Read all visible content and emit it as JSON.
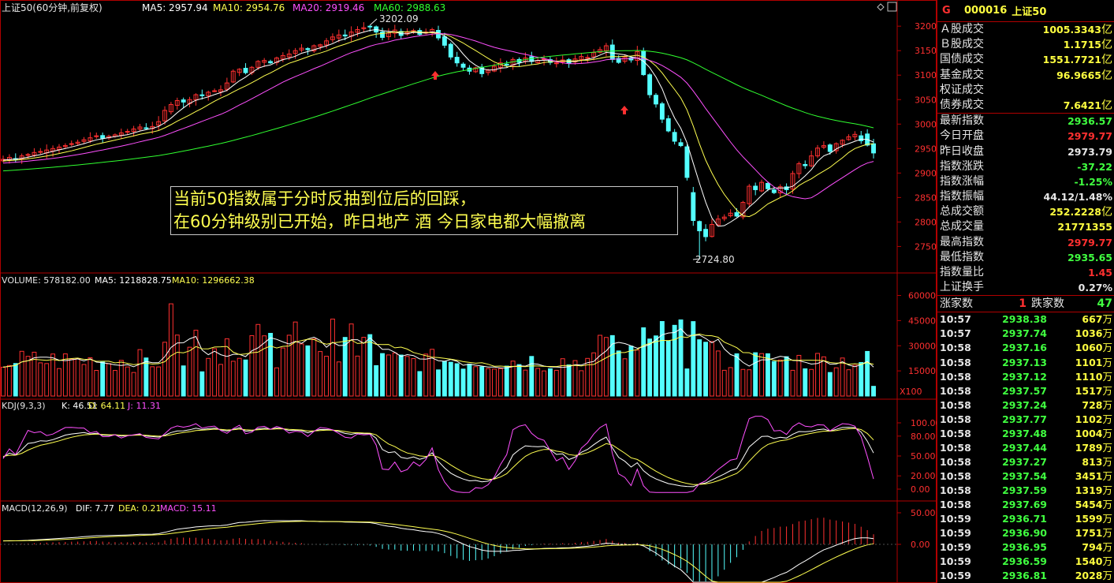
{
  "colors": {
    "up": "#ff3030",
    "down": "#54ffff",
    "ma5": "#ffffff",
    "ma10": "#ffff50",
    "ma20": "#ff50ff",
    "ma60": "#30ff30",
    "frame": "#b00000"
  },
  "kline": {
    "title": "上证50(60分钟,前复权)",
    "ma5": "MA5: 2957.94",
    "ma10": "MA10: 2954.76",
    "ma20": "MA20: 2919.46",
    "ma60": "MA60: 2988.63",
    "high_mark": "3202.09",
    "low_mark": "2724.80",
    "axis_ticks": [
      "3200",
      "3150",
      "3100",
      "3050",
      "3000",
      "2950",
      "2900",
      "2850",
      "2800",
      "2750"
    ]
  },
  "annotation": {
    "line1": "当前50指数属于分时反抽到位后的回踩，",
    "line2": "在60分钟级别已开始，昨日地产 酒  今日家电都大幅撤离"
  },
  "volume": {
    "label": "VOLUME: 578182.00",
    "ma5": "MA5: 1218828.75",
    "ma10": "MA10: 1296662.38",
    "axis_ticks": [
      "60000",
      "45000",
      "30000",
      "15000"
    ],
    "unit": "X100"
  },
  "kdj": {
    "label": "KDJ(9,3,3)",
    "k": "K: 46.51",
    "d": "D: 64.11",
    "j": "J: 11.31",
    "axis_ticks": [
      "100.00",
      "80.00",
      "50.00",
      "20.00",
      "0.00"
    ]
  },
  "macd": {
    "label": "MACD(12,26,9)",
    "dif": "DIF: 7.77",
    "dea": "DEA: 0.21",
    "macd": "MACD: 15.11",
    "axis_ticks": [
      "50.00",
      "0.00"
    ]
  },
  "side": {
    "g": "G",
    "code": "000016",
    "name": "上证50",
    "stats": [
      {
        "label": "Ａ股成交",
        "value": "1005.3343亿",
        "color": "#ffff40"
      },
      {
        "label": "Ｂ股成交",
        "value": "1.1715亿",
        "color": "#ffff40"
      },
      {
        "label": "国债成交",
        "value": "1551.7721亿",
        "color": "#ffff40"
      },
      {
        "label": "基金成交",
        "value": "96.9665亿",
        "color": "#ffff40"
      },
      {
        "label": "权证成交",
        "value": "",
        "color": "#ffff40"
      },
      {
        "label": "债券成交",
        "value": "7.6421亿",
        "color": "#ffff40"
      }
    ],
    "quotes": [
      {
        "label": "最新指数",
        "value": "2936.57",
        "color": "#40ff40"
      },
      {
        "label": "今日开盘",
        "value": "2979.77",
        "color": "#ff3030"
      },
      {
        "label": "昨日收盘",
        "value": "2973.79",
        "color": "#e6e6e6"
      },
      {
        "label": "指数涨跌",
        "value": "-37.22",
        "color": "#40ff40"
      },
      {
        "label": "指数涨幅",
        "value": "-1.25%",
        "color": "#40ff40"
      },
      {
        "label": "指数振幅",
        "value": "44.12/1.48%",
        "color": "#e6e6e6"
      },
      {
        "label": "总成交额",
        "value": "252.2228亿",
        "color": "#ffff40"
      },
      {
        "label": "总成交量",
        "value": "21771355",
        "color": "#ffff40"
      },
      {
        "label": "最高指数",
        "value": "2979.77",
        "color": "#ff3030"
      },
      {
        "label": "最低指数",
        "value": "2935.65",
        "color": "#40ff40"
      },
      {
        "label": "指数量比",
        "value": "1.45",
        "color": "#ff3030"
      },
      {
        "label": "上证换手",
        "value": "0.27%",
        "color": "#e6e6e6"
      }
    ],
    "up_label": "涨家数",
    "up_count": "1",
    "down_label": "跌家数",
    "down_count": "47",
    "ticks": [
      {
        "t": "10:57",
        "p": "2938.38",
        "v": "667万"
      },
      {
        "t": "10:57",
        "p": "2937.74",
        "v": "1036万"
      },
      {
        "t": "10:58",
        "p": "2937.16",
        "v": "1060万"
      },
      {
        "t": "10:58",
        "p": "2937.13",
        "v": "1101万"
      },
      {
        "t": "10:58",
        "p": "2937.12",
        "v": "1110万"
      },
      {
        "t": "10:58",
        "p": "2937.57",
        "v": "1517万"
      },
      {
        "t": "10:58",
        "p": "2937.24",
        "v": "728万"
      },
      {
        "t": "10:58",
        "p": "2937.77",
        "v": "1102万"
      },
      {
        "t": "10:58",
        "p": "2937.48",
        "v": "1004万"
      },
      {
        "t": "10:58",
        "p": "2937.44",
        "v": "1789万"
      },
      {
        "t": "10:58",
        "p": "2937.27",
        "v": "813万"
      },
      {
        "t": "10:58",
        "p": "2937.54",
        "v": "3451万"
      },
      {
        "t": "10:58",
        "p": "2937.59",
        "v": "1319万"
      },
      {
        "t": "10:58",
        "p": "2937.69",
        "v": "5454万"
      },
      {
        "t": "10:59",
        "p": "2936.71",
        "v": "1599万"
      },
      {
        "t": "10:59",
        "p": "2936.90",
        "v": "1751万"
      },
      {
        "t": "10:59",
        "p": "2936.95",
        "v": "794万"
      },
      {
        "t": "10:59",
        "p": "2936.59",
        "v": "1540万"
      },
      {
        "t": "10:59",
        "p": "2936.81",
        "v": "2028万"
      }
    ]
  },
  "chart_data": [
    {
      "type": "candlestick",
      "title": "上证50(60分钟,前复权)",
      "y_ticks": [
        2750,
        2800,
        2850,
        2900,
        2950,
        3000,
        3050,
        3100,
        3150,
        3200
      ],
      "ylim": [
        2712,
        3218
      ],
      "series": [
        {
          "name": "MA5",
          "last": 2957.94
        },
        {
          "name": "MA10",
          "last": 2954.76
        },
        {
          "name": "MA20",
          "last": 2919.46
        },
        {
          "name": "MA60",
          "last": 2988.63
        }
      ],
      "annotations": [
        "3202.09",
        "2724.80"
      ],
      "close": [
        2928,
        2932,
        2929,
        2935,
        2938,
        2942,
        2944,
        2947,
        2950,
        2953,
        2956,
        2960,
        2963,
        2968,
        2972,
        2976,
        2971,
        2975,
        2978,
        2982,
        2985,
        2990,
        2994,
        2992,
        2995,
        3005,
        3028,
        3040,
        3048,
        3045,
        3050,
        3060,
        3058,
        3065,
        3068,
        3070,
        3084,
        3108,
        3112,
        3105,
        3116,
        3128,
        3130,
        3125,
        3135,
        3140,
        3143,
        3150,
        3155,
        3152,
        3160,
        3162,
        3170,
        3178,
        3182,
        3180,
        3188,
        3193,
        3197,
        3199,
        3188,
        3177,
        3186,
        3192,
        3181,
        3187,
        3191,
        3183,
        3188,
        3193,
        3176,
        3161,
        3137,
        3125,
        3116,
        3108,
        3115,
        3103,
        3110,
        3118,
        3125,
        3121,
        3132,
        3126,
        3135,
        3128,
        3130,
        3133,
        3126,
        3125,
        3131,
        3124,
        3133,
        3138,
        3136,
        3146,
        3152,
        3160,
        3132,
        3126,
        3137,
        3131,
        3148,
        3101,
        3060,
        3041,
        3010,
        2986,
        2965,
        2956,
        2891,
        2803,
        2782,
        2770,
        2795,
        2806,
        2810,
        2818,
        2812,
        2840,
        2873,
        2866,
        2881,
        2868,
        2860,
        2872,
        2866,
        2899,
        2919,
        2915,
        2935,
        2951,
        2956,
        2944,
        2960,
        2967,
        2974,
        2979,
        2966,
        2957,
        2941
      ]
    },
    {
      "type": "bar",
      "title": "VOLUME",
      "y_ticks": [
        15000,
        30000,
        45000,
        60000
      ],
      "unit": "X100",
      "series": [
        {
          "name": "VOLUME",
          "last": 578182.0
        },
        {
          "name": "MA5",
          "last": 1218828.75
        },
        {
          "name": "MA10",
          "last": 1296662.38
        }
      ]
    },
    {
      "type": "line",
      "title": "KDJ(9,3,3)",
      "y_ticks": [
        0,
        20,
        50,
        80,
        100
      ],
      "series": [
        {
          "name": "K",
          "last": 46.51
        },
        {
          "name": "D",
          "last": 64.11
        },
        {
          "name": "J",
          "last": 11.31
        }
      ]
    },
    {
      "type": "line",
      "title": "MACD(12,26,9)",
      "y_ticks": [
        0,
        50
      ],
      "series": [
        {
          "name": "DIF",
          "last": 7.77
        },
        {
          "name": "DEA",
          "last": 0.21
        },
        {
          "name": "MACD",
          "last": 15.11
        }
      ]
    }
  ]
}
